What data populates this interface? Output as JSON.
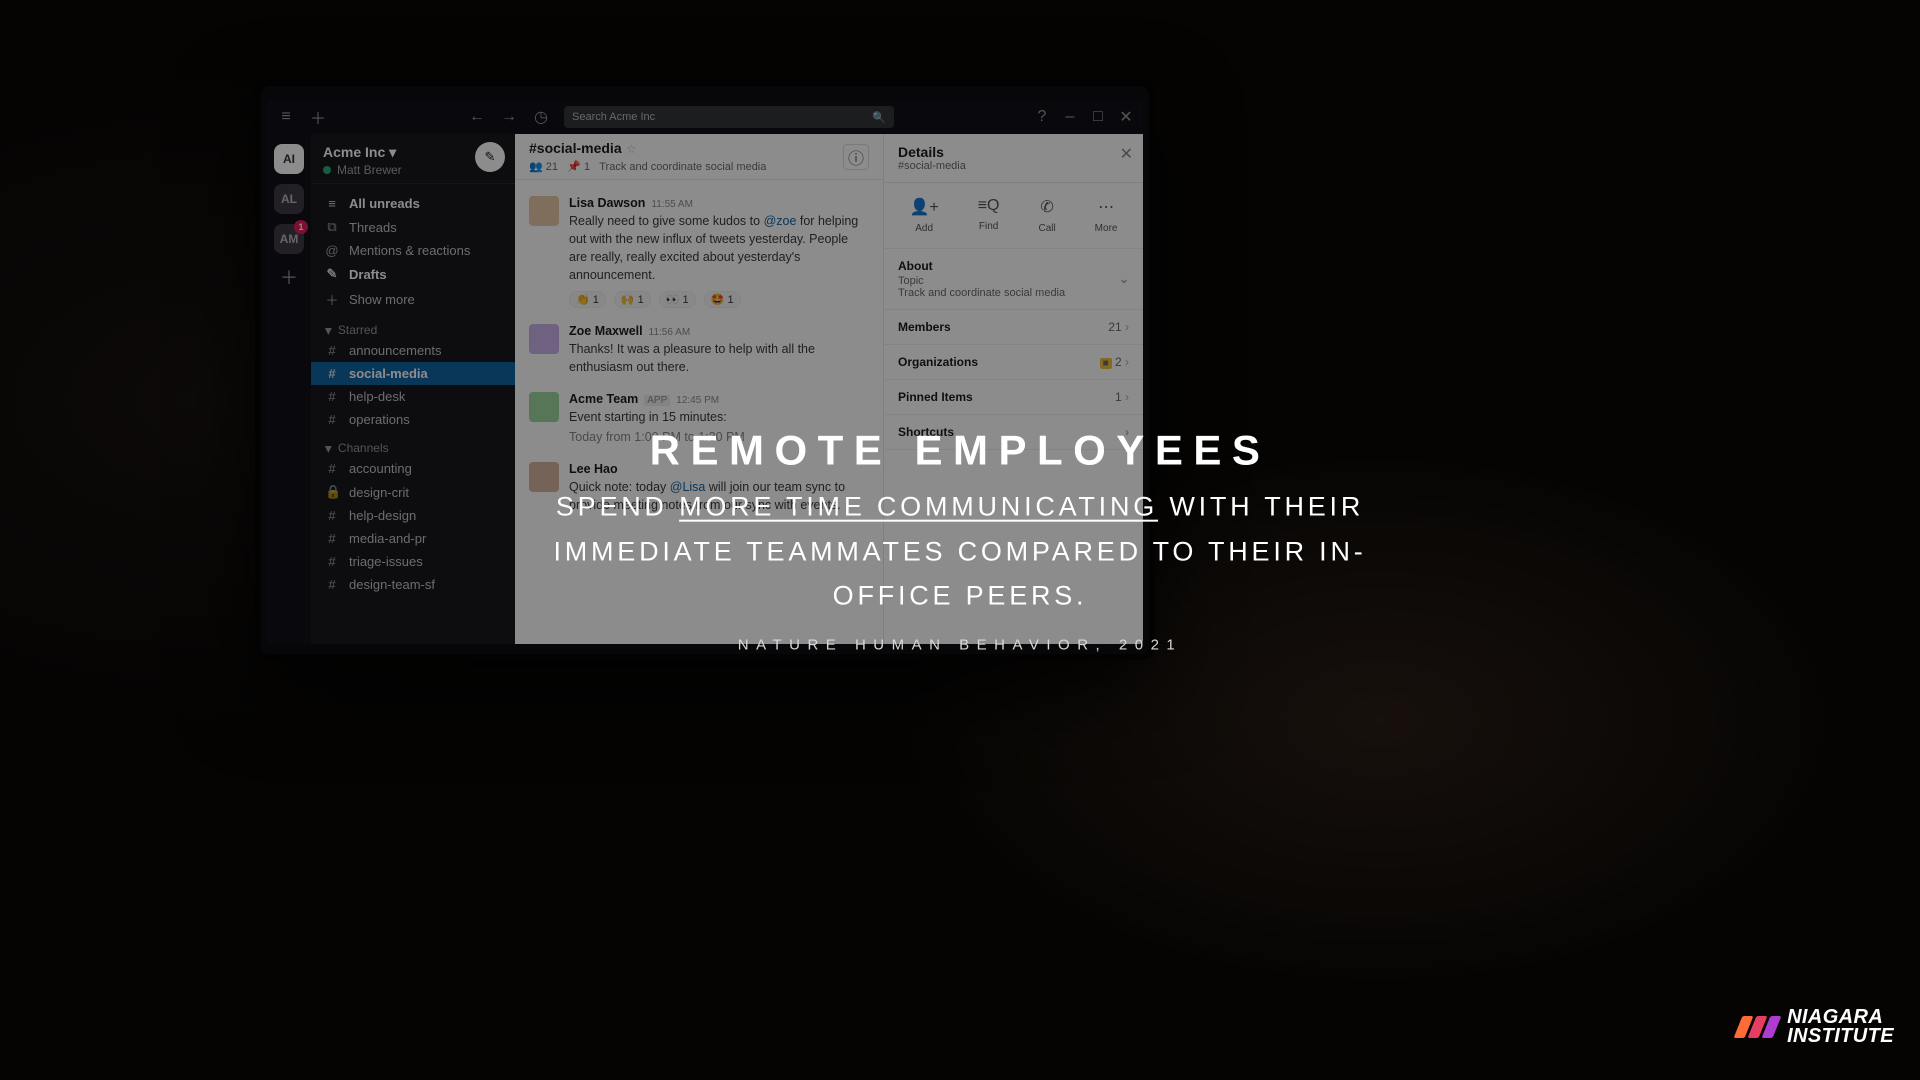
{
  "titlebar": {
    "search_placeholder": "Search Acme Inc"
  },
  "workspaces": [
    {
      "abbr": "AI",
      "badge": null
    },
    {
      "abbr": "AL",
      "badge": null
    },
    {
      "abbr": "AM",
      "badge": "1"
    }
  ],
  "sidebar": {
    "workspace_name": "Acme Inc",
    "user_name": "Matt Brewer",
    "nav": {
      "unreads": "All unreads",
      "threads": "Threads",
      "mentions": "Mentions & reactions",
      "drafts": "Drafts",
      "show_more": "Show more"
    },
    "sections": [
      {
        "title": "Starred",
        "items": [
          "announcements",
          "social-media",
          "help-desk",
          "operations"
        ]
      },
      {
        "title": "Channels",
        "items": [
          "accounting",
          "design-crit",
          "help-design",
          "media-and-pr",
          "triage-issues",
          "design-team-sf"
        ]
      }
    ],
    "selected": "social-media"
  },
  "channel": {
    "name": "#social-media",
    "member_count": "21",
    "pins_count": "1",
    "topic": "Track and coordinate social media",
    "messages": [
      {
        "who": "Lisa Dawson",
        "time": "11:55 AM",
        "avatar_color": "#e9c9a9",
        "text_before": "Really need to give some kudos to ",
        "mention": "@zoe",
        "text_after": " for helping out with the new influx of tweets yesterday. People are really, really excited about yesterday's announcement.",
        "reactions": [
          {
            "e": "👏",
            "n": "1"
          },
          {
            "e": "🙌",
            "n": "1"
          },
          {
            "e": "👀",
            "n": "1"
          },
          {
            "e": "🤩",
            "n": "1"
          }
        ]
      },
      {
        "who": "Zoe Maxwell",
        "time": "11:56 AM",
        "avatar_color": "#c9b3e9",
        "text": "Thanks! It was a pleasure to help with all the enthusiasm out there."
      },
      {
        "who": "Acme Team",
        "app": true,
        "time": "12:45 PM",
        "avatar_color": "#9fd69f",
        "text": "Event starting in 15 minutes:",
        "sub": "Today from 1:00 PM to 1:30 PM"
      },
      {
        "who": "Lee Hao",
        "time": "",
        "avatar_color": "#d6b49f",
        "text_before": "Quick note: today ",
        "mention": "@Lisa",
        "text_after": " will join our team sync to provide meeting notes from our sync with events."
      }
    ]
  },
  "details": {
    "title": "Details",
    "sub": "#social-media",
    "actions": {
      "add": "Add",
      "find": "Find",
      "call": "Call",
      "more": "More"
    },
    "about": {
      "label": "About",
      "topic_label": "Topic",
      "topic": "Track and coordinate social media"
    },
    "members": {
      "label": "Members",
      "count": "21"
    },
    "orgs": {
      "label": "Organizations",
      "count": "2"
    },
    "pinned": {
      "label": "Pinned Items",
      "count": "1"
    },
    "shortcuts": {
      "label": "Shortcuts"
    }
  },
  "overlay": {
    "h1": "REMOTE EMPLOYEES",
    "line_before": "SPEND ",
    "underline": "MORE TIME COMMUNICATING",
    "line_after": " WITH THEIR IMMEDIATE TEAMMATES COMPARED TO THEIR IN-OFFICE PEERS.",
    "source": "NATURE HUMAN BEHAVIOR, 2021"
  },
  "logo": {
    "line1": "NIAGARA",
    "line2": "INSTITUTE"
  }
}
